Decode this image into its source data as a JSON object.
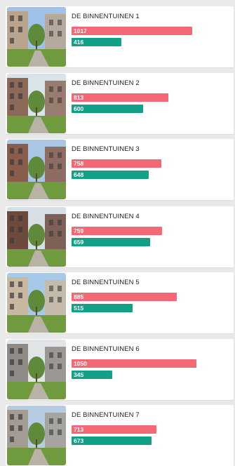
{
  "colors": {
    "red": "#f46774",
    "green": "#12a186"
  },
  "bar_scale_max": 1050,
  "items": [
    {
      "title": "DE BINNENTUINEN 1",
      "red": 1017,
      "green": 416,
      "thumb": "residential-courtyard-photo"
    },
    {
      "title": "DE BINNENTUINEN 2",
      "red": 813,
      "green": 600,
      "thumb": "residential-courtyard-photo"
    },
    {
      "title": "DE BINNENTUINEN 3",
      "red": 758,
      "green": 648,
      "thumb": "residential-courtyard-photo"
    },
    {
      "title": "DE BINNENTUINEN 4",
      "red": 759,
      "green": 659,
      "thumb": "residential-courtyard-photo"
    },
    {
      "title": "DE BINNENTUINEN 5",
      "red": 885,
      "green": 515,
      "thumb": "residential-courtyard-photo"
    },
    {
      "title": "DE BINNENTUINEN 6",
      "red": 1050,
      "green": 345,
      "thumb": "residential-courtyard-photo"
    },
    {
      "title": "DE BINNENTUINEN 7",
      "red": 713,
      "green": 673,
      "thumb": "residential-courtyard-photo"
    }
  ]
}
